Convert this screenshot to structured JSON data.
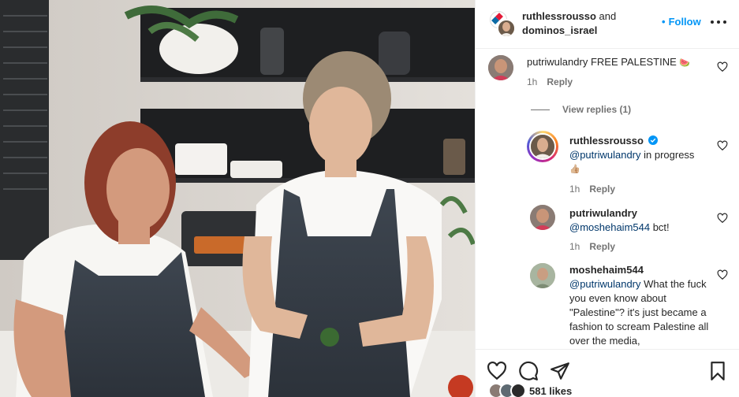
{
  "header": {
    "user1": "ruthlessrousso",
    "and_text": "and",
    "user2": "dominos_israel",
    "separator": "•",
    "follow_label": "Follow"
  },
  "comments": [
    {
      "user": "putriwulandry",
      "text": "FREE PALESTINE",
      "emoji": "🍉",
      "time": "1h",
      "reply_label": "Reply",
      "view_replies": "View replies (1)"
    },
    {
      "user": "ruthlessrousso",
      "verified": true,
      "mention": "@putriwulandry",
      "text": " in progress",
      "emoji": "👍🏼",
      "time": "1h",
      "reply_label": "Reply"
    },
    {
      "user": "putriwulandry",
      "mention": "@moshehaim544",
      "text": " bct!",
      "time": "1h",
      "reply_label": "Reply"
    },
    {
      "user": "moshehaim544",
      "mention": "@putriwulandry",
      "text": " What the fuck you even know about \"Palestine\"? it's just became a fashion to scream Palestine all over the media,"
    }
  ],
  "actions": {
    "like_icon": "heart-icon",
    "comment_icon": "comment-icon",
    "share_icon": "share-icon",
    "save_icon": "bookmark-icon"
  },
  "likes": {
    "text": "581 likes"
  },
  "colors": {
    "link_blue": "#0095f6",
    "mention": "#00376b",
    "muted": "#737373",
    "verified": "#0095f6"
  }
}
